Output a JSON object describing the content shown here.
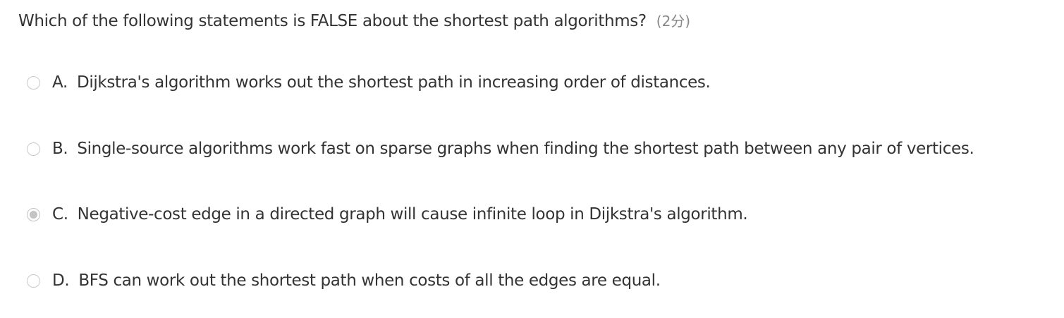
{
  "question": {
    "text": "Which of the following statements is FALSE about the shortest path algorithms?",
    "points": "(2分)"
  },
  "options": [
    {
      "letter": "A.",
      "text": "Dijkstra's algorithm works out the shortest path in increasing order of distances.",
      "selected": false
    },
    {
      "letter": "B.",
      "text": "Single-source algorithms work fast on sparse graphs when finding the shortest path between any pair of vertices.",
      "selected": false
    },
    {
      "letter": "C.",
      "text": "Negative-cost edge in a directed graph will cause infinite loop in Dijkstra's algorithm.",
      "selected": true
    },
    {
      "letter": "D.",
      "text": "BFS can work out the shortest path when costs of all the edges are equal.",
      "selected": false
    }
  ],
  "colors": {
    "text": "#333333",
    "points": "#888888",
    "radio_border": "#c9c9c9",
    "radio_checked_dot": "#c4c4c4"
  }
}
